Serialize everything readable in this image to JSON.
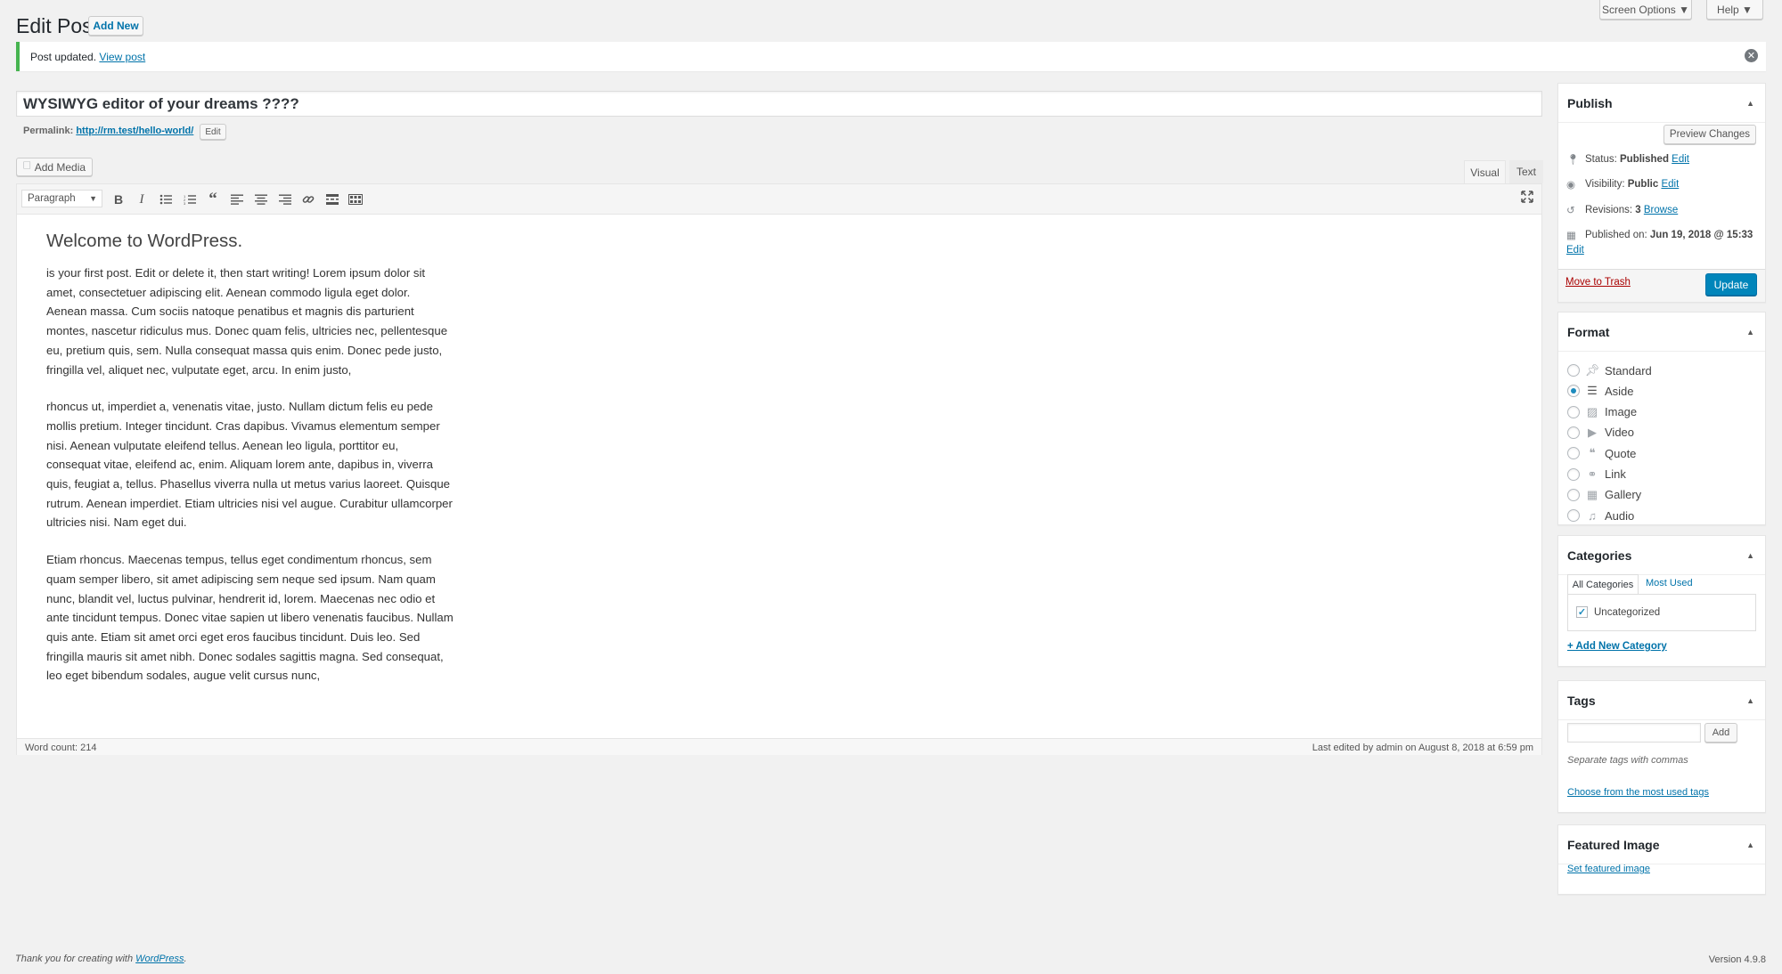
{
  "header": {
    "title": "Edit Post",
    "add_new": "Add New",
    "screen_options": "Screen Options ▼",
    "help": "Help ▼"
  },
  "notice": {
    "text": "Post updated.",
    "link": "View post"
  },
  "post": {
    "title": "WYSIWYG editor of your dreams ????",
    "permalink_label": "Permalink:",
    "permalink_url": "http://rm.test/hello-world/",
    "edit_label": "Edit"
  },
  "editor": {
    "add_media": "Add Media",
    "tab_visual": "Visual",
    "tab_text": "Text",
    "format_select": "Paragraph",
    "heading": "Welcome to WordPress.",
    "paragraphs": [
      [
        "is your first post. Edit or delete it, then start writing! Lorem ipsum dolor sit",
        "amet, consectetuer adipiscing elit. Aenean commodo ligula eget dolor.",
        "Aenean massa. Cum sociis natoque penatibus et magnis dis parturient",
        "montes, nascetur ridiculus mus. Donec quam felis, ultricies nec, pellentesque",
        "eu, pretium quis, sem. Nulla consequat massa quis enim. Donec pede justo,",
        "fringilla vel, aliquet nec, vulputate eget, arcu. In enim justo,"
      ],
      [
        "rhoncus ut, imperdiet a, venenatis vitae, justo. Nullam dictum felis eu pede",
        "mollis pretium. Integer tincidunt. Cras dapibus. Vivamus elementum semper",
        "nisi. Aenean vulputate eleifend tellus. Aenean leo ligula, porttitor eu,",
        "consequat vitae, eleifend ac, enim. Aliquam lorem ante, dapibus in, viverra",
        "quis, feugiat a, tellus. Phasellus viverra nulla ut metus varius laoreet. Quisque",
        "rutrum. Aenean imperdiet. Etiam ultricies nisi vel augue. Curabitur ullamcorper",
        "ultricies nisi. Nam eget dui."
      ],
      [
        "Etiam rhoncus. Maecenas tempus, tellus eget condimentum rhoncus, sem",
        "quam semper libero, sit amet adipiscing sem neque sed ipsum. Nam quam",
        "nunc, blandit vel, luctus pulvinar, hendrerit id, lorem. Maecenas nec odio et",
        "ante tincidunt tempus. Donec vitae sapien ut libero venenatis faucibus. Nullam",
        "quis ante. Etiam sit amet orci eget eros faucibus tincidunt. Duis leo. Sed",
        "fringilla mauris sit amet nibh. Donec sodales sagittis magna. Sed consequat,",
        "leo eget bibendum sodales, augue velit cursus nunc,"
      ]
    ],
    "word_count": "Word count: 214",
    "last_edited": "Last edited by admin on August 8, 2018 at 6:59 pm"
  },
  "publish": {
    "title": "Publish",
    "preview": "Preview Changes",
    "status_label": "Status:",
    "status_value": "Published",
    "status_edit": "Edit",
    "visibility_label": "Visibility:",
    "visibility_value": "Public",
    "visibility_edit": "Edit",
    "revisions_label": "Revisions:",
    "revisions_value": "3",
    "revisions_link": "Browse",
    "published_label": "Published on:",
    "published_value": "Jun 19, 2018 @ 15:33",
    "published_edit": "Edit",
    "trash": "Move to Trash",
    "update": "Update"
  },
  "format": {
    "title": "Format",
    "options": [
      "Standard",
      "Aside",
      "Image",
      "Video",
      "Quote",
      "Link",
      "Gallery",
      "Audio"
    ],
    "selected": "Aside"
  },
  "categories": {
    "title": "Categories",
    "tab_all": "All Categories",
    "tab_most": "Most Used",
    "items": [
      "Uncategorized"
    ],
    "add_new": "+ Add New Category"
  },
  "tags": {
    "title": "Tags",
    "add": "Add",
    "hint": "Separate tags with commas",
    "choose": "Choose from the most used tags"
  },
  "featured": {
    "title": "Featured Image",
    "set": "Set featured image"
  },
  "footer": {
    "thanks": "Thank you for creating with",
    "wp": "WordPress",
    "version": "Version 4.9.8"
  },
  "colors": {
    "accent": "#0073aa",
    "button_primary": "#0085ba",
    "notice_border": "#46b450"
  }
}
